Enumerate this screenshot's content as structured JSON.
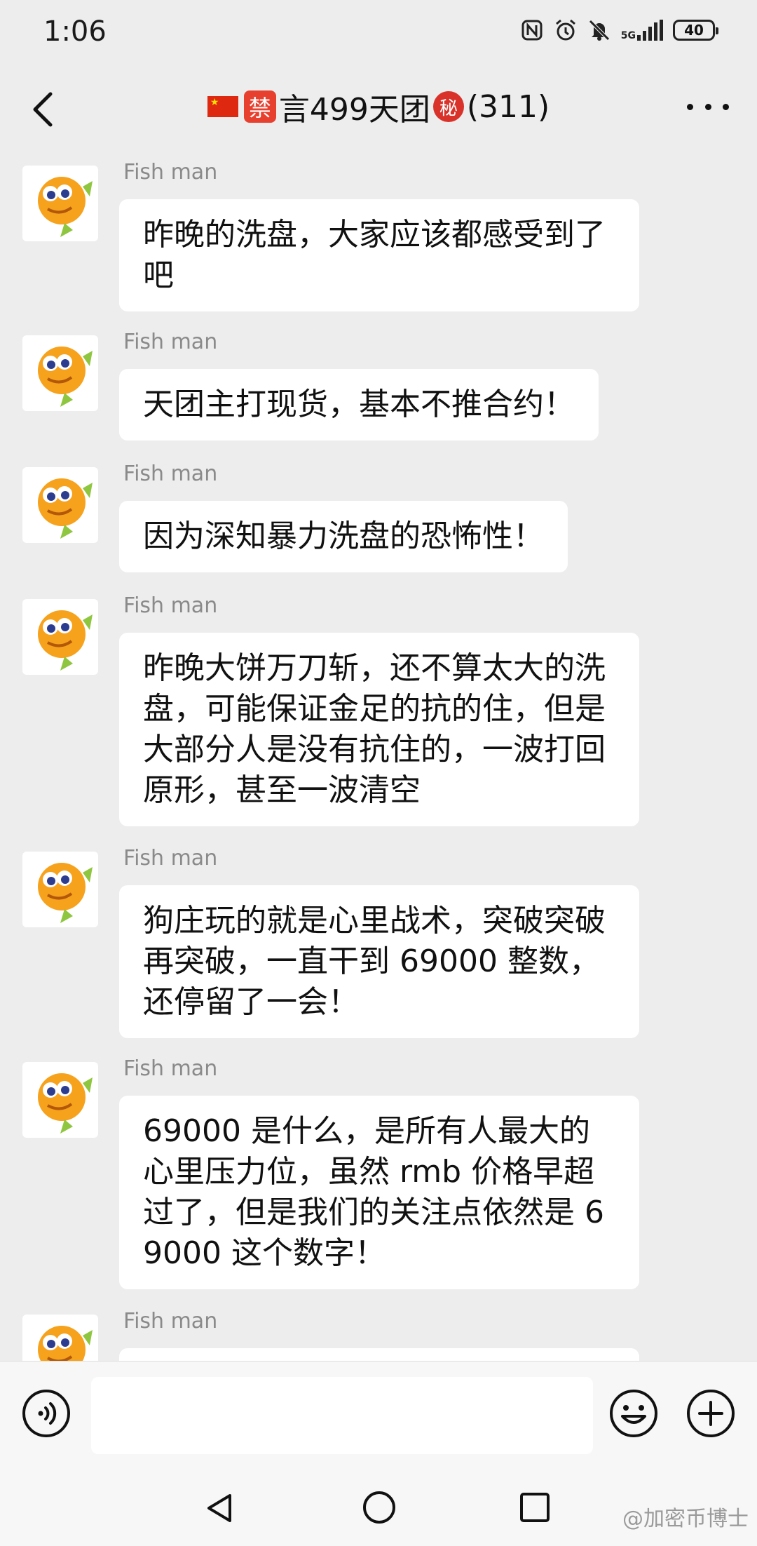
{
  "status_bar": {
    "time": "1:06",
    "network": "5G",
    "battery": "40"
  },
  "header": {
    "badge_mute": "禁",
    "title_main": "言499天团",
    "badge_secret": "秘",
    "member_count": "(311)"
  },
  "messages": [
    {
      "sender": "Fish man",
      "text": "昨晚的洗盘，大家应该都感受到了吧"
    },
    {
      "sender": "Fish man",
      "text": "天团主打现货，基本不推合约！"
    },
    {
      "sender": "Fish man",
      "text": "因为深知暴力洗盘的恐怖性！"
    },
    {
      "sender": "Fish man",
      "text": "昨晚大饼万刀斩，还不算太大的洗盘，可能保证金足的抗的住，但是大部分人是没有抗住的，一波打回原形，甚至一波清空"
    },
    {
      "sender": "Fish man",
      "text": "狗庄玩的就是心里战术，突破突破再突破，一直干到 69000 整数，还停留了一会！"
    },
    {
      "sender": "Fish man",
      "text": "69000 是什么，是所有人最大的心里压力位，虽然 rmb 价格早超过了，但是我们的关注点依然是 69000 这个数字！"
    },
    {
      "sender": "Fish man",
      "text": ""
    }
  ],
  "input": {
    "value": ""
  },
  "watermark": "@加密币博士",
  "icons": {
    "back": "chevron-left-icon",
    "more": "more-dots-icon",
    "voice": "voice-icon",
    "emoji": "emoji-icon",
    "plus": "plus-icon"
  }
}
